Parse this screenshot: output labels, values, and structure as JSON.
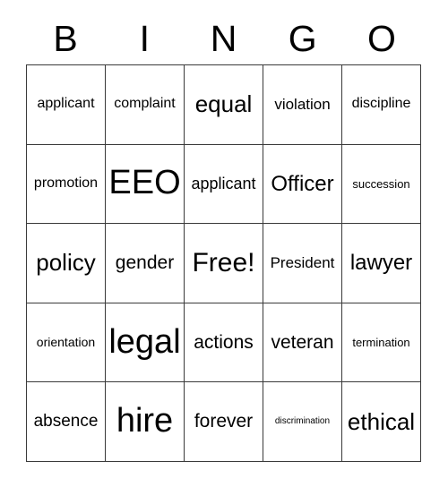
{
  "card": {
    "title": "BINGO",
    "header_letters": [
      "B",
      "I",
      "N",
      "G",
      "O"
    ],
    "grid_size": "5x5",
    "free_space_label": "Free!",
    "free_space_position": "row3-col3",
    "border_color": "#3a3a3a",
    "text_color": "#000000",
    "background_color": "#ffffff",
    "rows": [
      {
        "cells": [
          {
            "text": "applicant",
            "size": 16
          },
          {
            "text": "complaint",
            "size": 16
          },
          {
            "text": "equal",
            "size": 26
          },
          {
            "text": "violation",
            "size": 17
          },
          {
            "text": "discipline",
            "size": 16
          }
        ]
      },
      {
        "cells": [
          {
            "text": "promotion",
            "size": 16
          },
          {
            "text": "EEO",
            "size": 38
          },
          {
            "text": "applicant",
            "size": 18
          },
          {
            "text": "Officer",
            "size": 24
          },
          {
            "text": "succession",
            "size": 13
          }
        ]
      },
      {
        "cells": [
          {
            "text": "policy",
            "size": 26
          },
          {
            "text": "gender",
            "size": 21
          },
          {
            "text": "Free!",
            "size": 30
          },
          {
            "text": "President",
            "size": 17
          },
          {
            "text": "lawyer",
            "size": 24
          }
        ]
      },
      {
        "cells": [
          {
            "text": "orientation",
            "size": 14
          },
          {
            "text": "legal",
            "size": 38
          },
          {
            "text": "actions",
            "size": 21
          },
          {
            "text": "veteran",
            "size": 21
          },
          {
            "text": "termination",
            "size": 13
          }
        ]
      },
      {
        "cells": [
          {
            "text": "absence",
            "size": 19
          },
          {
            "text": "hire",
            "size": 38
          },
          {
            "text": "forever",
            "size": 21
          },
          {
            "text": "discrimination",
            "size": 10
          },
          {
            "text": "ethical",
            "size": 26
          }
        ]
      }
    ]
  }
}
